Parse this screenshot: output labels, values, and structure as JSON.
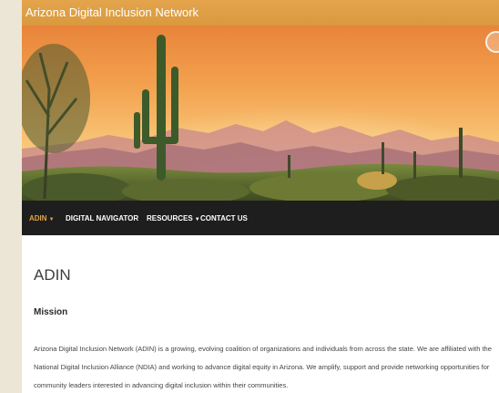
{
  "site": {
    "title": "Arizona Digital Inclusion Network"
  },
  "nav": {
    "items": [
      {
        "label": "ADIN",
        "has_dropdown": true,
        "active": true
      },
      {
        "label": "DIGITAL NAVIGATOR",
        "has_dropdown": false,
        "active": false
      },
      {
        "label": "RESOURCES",
        "has_dropdown": true,
        "active": false
      },
      {
        "label": "CONTACT US",
        "has_dropdown": false,
        "active": false
      }
    ],
    "caret": "▼"
  },
  "main": {
    "page_title": "ADIN",
    "section_title": "Mission",
    "paragraph": "Arizona Digital Inclusion Network (ADIN) is a growing, evolving coalition of organizations and individuals from across the state. We are affiliated with the National Digital Inclusion Alliance (NDIA) and working to advance digital equity in Arizona. We amplify, support and provide networking opportunities for community leaders interested in advancing digital inclusion within their communities."
  },
  "colors": {
    "header_bar": "#d99a3e",
    "nav_background": "#1e1e1e",
    "nav_active": "#e2a447",
    "page_background": "#ece6d6"
  },
  "hero": {
    "icon": "desert-landscape-image"
  }
}
